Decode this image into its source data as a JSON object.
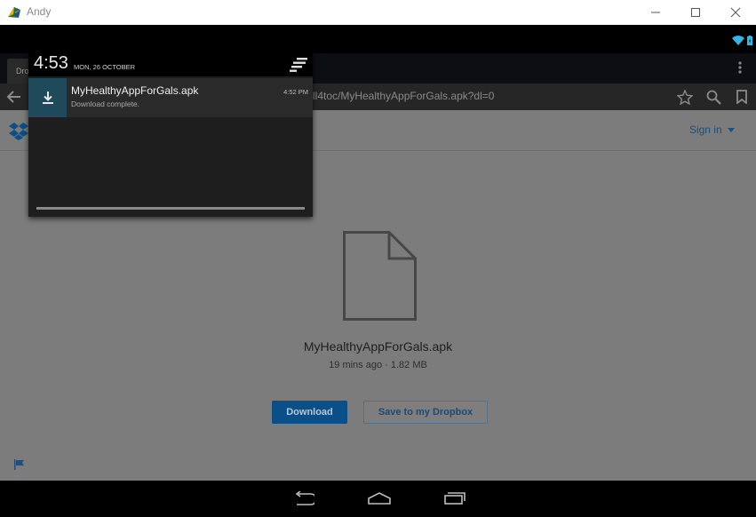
{
  "window": {
    "title": "Andy"
  },
  "browser": {
    "tab_label": "Dro",
    "url": "ll4toc/MyHealthyAppForGals.apk?dl=0"
  },
  "page": {
    "sign_in": "Sign in",
    "file_name": "MyHealthyAppForGals.apk",
    "file_meta": "19 mins ago · 1.82 MB",
    "download_button": "Download",
    "save_button": "Save to my Dropbox"
  },
  "notification_shade": {
    "time": "4:53",
    "date": "MON, 26 OCTOBER",
    "notification": {
      "title": "MyHealthyAppForGals.apk",
      "subtitle": "Download complete.",
      "time": "4:52 PM"
    }
  },
  "colors": {
    "dropbox_blue": "#0b4f88",
    "notif_icon_bg": "#1f4a5c",
    "wifi_blue": "#33b5e5"
  },
  "icons": [
    "andy-app-icon",
    "minimize-icon",
    "maximize-icon",
    "close-icon",
    "wifi-icon",
    "battery-icon",
    "overflow-menu-icon",
    "back-arrow-icon",
    "star-icon",
    "search-icon",
    "bookmark-icon",
    "dropbox-logo-icon",
    "file-icon",
    "flag-icon",
    "quick-settings-icon",
    "download-icon",
    "nav-back-icon",
    "nav-home-icon",
    "nav-recents-icon"
  ]
}
